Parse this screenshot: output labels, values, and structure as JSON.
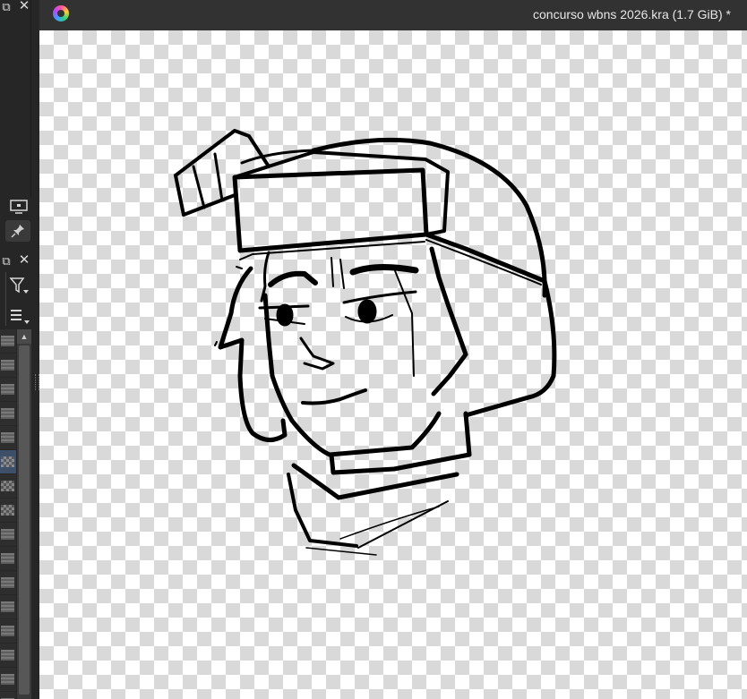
{
  "window": {
    "document_title": "concurso wbns 2026.kra (1.7 GiB) *"
  },
  "icons": {
    "app_logo": "krita-logo-icon",
    "float": "float-docker-icon",
    "close": "close-icon",
    "canvas_only": "canvas-only-icon",
    "pin": "pin-icon",
    "filter": "filter-icon",
    "menu": "hamburger-menu-icon"
  },
  "glyphs": {
    "float": "⧉",
    "close": "✕",
    "scroll_up": "▲"
  },
  "layers": {
    "rows": [
      {
        "kind": "lines"
      },
      {
        "kind": "lines"
      },
      {
        "kind": "lines"
      },
      {
        "kind": "lines"
      },
      {
        "kind": "lines"
      },
      {
        "kind": "selected"
      },
      {
        "kind": "checker"
      },
      {
        "kind": "checker"
      },
      {
        "kind": "lines"
      },
      {
        "kind": "lines"
      },
      {
        "kind": "lines"
      },
      {
        "kind": "lines"
      },
      {
        "kind": "lines"
      },
      {
        "kind": "lines"
      },
      {
        "kind": "lines"
      },
      {
        "kind": "lines"
      }
    ]
  },
  "colors": {
    "selected_layer": "#3e5069",
    "panel_bg": "#262626",
    "titlebar_bg": "#323232"
  }
}
